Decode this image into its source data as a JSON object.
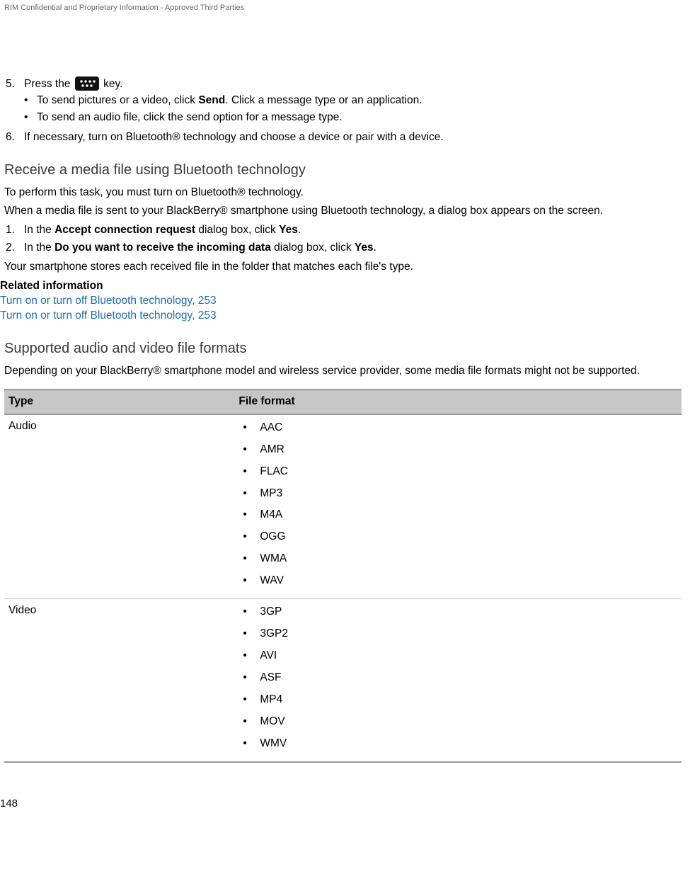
{
  "header": "RIM Confidential and Proprietary Information - Approved Third Parties",
  "steps": {
    "s5num": "5.",
    "s5a": "Press the ",
    "s5b": " key.",
    "s5_b1a": "To send pictures or a video, click ",
    "s5_b1b": "Send",
    "s5_b1c": ". Click a message type or an application.",
    "s5_b2": "To send an audio file, click the send option for a message type.",
    "s6num": "6.",
    "s6": "If necessary, turn on Bluetooth® technology and choose a device or pair with a device."
  },
  "section1": {
    "title": "Receive a media file using Bluetooth technology",
    "p1": "To perform this task, you must turn on Bluetooth® technology.",
    "p2": "When a media file is sent to your BlackBerry® smartphone using Bluetooth technology, a dialog box appears on the screen.",
    "li1num": "1.",
    "li1a": "In the ",
    "li1b": "Accept connection request",
    "li1c": " dialog box, click ",
    "li1d": "Yes",
    "li1e": ".",
    "li2num": "2.",
    "li2a": "In the ",
    "li2b": "Do you want to receive the incoming data",
    "li2c": " dialog box, click ",
    "li2d": "Yes",
    "li2e": ".",
    "p3": "Your smartphone stores each received file in the folder that matches each file's type.",
    "related_heading": "Related information",
    "link1": "Turn on or turn off Bluetooth technology, 253",
    "link2": "Turn on or turn off Bluetooth technology, 253"
  },
  "section2": {
    "title": "Supported audio and video file formats",
    "p1": "Depending on your BlackBerry® smartphone model and wireless service provider, some media file formats might not be supported."
  },
  "table": {
    "h1": "Type",
    "h2": "File format",
    "row1_type": "Audio",
    "audio": {
      "a1": "AAC",
      "a2": "AMR",
      "a3": "FLAC",
      "a4": "MP3",
      "a5": "M4A",
      "a6": "OGG",
      "a7": "WMA",
      "a8": "WAV"
    },
    "row2_type": "Video",
    "video": {
      "v1": "3GP",
      "v2": "3GP2",
      "v3": "AVI",
      "v4": "ASF",
      "v5": "MP4",
      "v6": "MOV",
      "v7": "WMV"
    }
  },
  "pagenum": "148"
}
